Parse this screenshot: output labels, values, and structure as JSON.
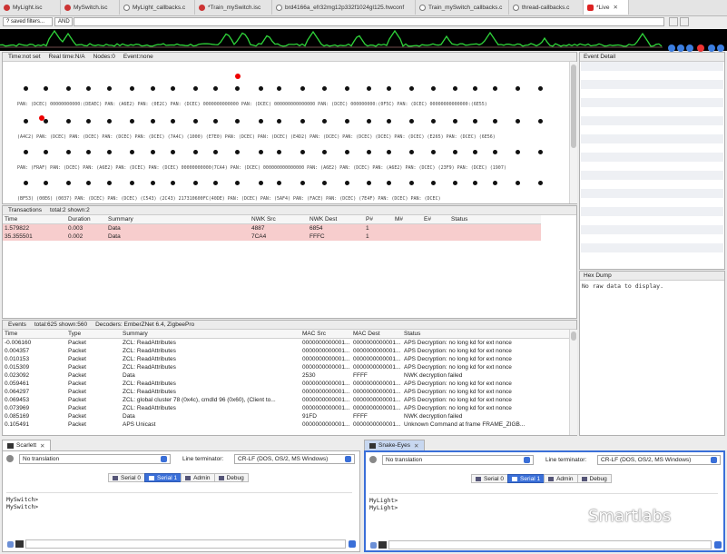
{
  "tabs": [
    {
      "label": "MyLight.isc",
      "icon": "red",
      "width": 67
    },
    {
      "label": "MySwitch.isc",
      "icon": "red",
      "width": 65
    },
    {
      "label": "MyLight_callbacks.c",
      "icon": "c",
      "width": 83
    },
    {
      "label": "*Train_mySwitch.isc",
      "icon": "red",
      "width": 85
    },
    {
      "label": "brd4166a_efr32mg12p332f1024gl125.hwconf",
      "icon": "c",
      "width": 158
    },
    {
      "label": "Train_mySwitch_callbacks.c",
      "icon": "c",
      "width": 103
    },
    {
      "label": "thread-callbacks.c",
      "icon": "c",
      "width": 82
    },
    {
      "label": "*Live",
      "icon": "live",
      "width": 50,
      "active": true
    }
  ],
  "filter": {
    "saved": "? saved filters...",
    "mode": "AND"
  },
  "network": {
    "status": [
      "Time:not set",
      "Real time:N/A",
      "Nodes:0",
      "Event:none"
    ],
    "row1_text": "PAN: (DCEC) 00000000000:(DEAEC)   PAN: (A6E2)   PAN: (0E2C) PAN: (DCEC) 0000000000000 PAN: (DCEC) 000000000000000 PAN: (DCEC) 000000000:(0F5C)   PAN: (DCEC) 00000000000000:(6E55)",
    "row2_text": "(A4C2)  PAN: (DCEC) PAN: (DCEC)  PAN: (DCEC) PAN: (DCEC) (7A4C)  (1000)  (E7E0)  PAN: (DCEC) PAN: (DCEC) (E4D2) PAN: (DCEC) PAN: (DCEC) (DCEC)  PAN: (DCEC) (E265)  PAN: (DCEC) (6E56)",
    "row3_text": "PAN: (FRAF)  PAN: (DCEC)  PAN: (A6E2)  PAN: (DCEC) PAN: (DCEC) 00000000000(7CA4)  PAN: (DCEC) 000000000000000 PAN: (A6E2) PAN: (DCEC) PAN: (A6E2) PAN: (DCEC) (23F9) PAN: (DCEC) (1907)",
    "row4_text": "(BF53)   (00E6)  (0037)  PAN: (DCEC) PAN: (DCEC) (C543)  (2C43)  217310600FC(40DE) PAN: (DCEC) PAN: (5AF4) PAN: (FACE) PAN: (DCEC) (7E4F)  PAN: (DCEC) PAN: (DCEC)"
  },
  "transactions": {
    "title": "Transactions",
    "summary": "total:2 shown:2",
    "columns": [
      "Time",
      "Duration",
      "Summary",
      "NWK Src",
      "NWK Dest",
      "P#",
      "M#",
      "E#",
      "Status"
    ],
    "rows": [
      [
        "1.579822",
        "0.003",
        "Data",
        "4887",
        "6854",
        "1",
        "",
        "",
        ""
      ],
      [
        "35.355501",
        "0.002",
        "Data",
        "7CA4",
        "FFFC",
        "1",
        "",
        "",
        ""
      ]
    ]
  },
  "events": {
    "title": "Events",
    "summary": "total:625 shown:560",
    "decoders": "Decoders: EmberZNet 6.4, ZigbeePro",
    "columns": [
      "Time",
      "Type",
      "Summary",
      "MAC Src",
      "MAC Dest",
      "Status"
    ],
    "rows": [
      [
        "-0.006160",
        "Packet",
        "ZCL: ReadAttributes",
        "0000000000001...",
        "0000000000001...",
        "APS Decryption: no long kd for ext nonce"
      ],
      [
        "0.004357",
        "Packet",
        "ZCL: ReadAttributes",
        "0000000000001...",
        "0000000000001...",
        "APS Decryption: no long kd for ext nonce"
      ],
      [
        "0.010153",
        "Packet",
        "ZCL: ReadAttributes",
        "0000000000001...",
        "0000000000001...",
        "APS Decryption: no long kd for ext nonce"
      ],
      [
        "0.015309",
        "Packet",
        "ZCL: ReadAttributes",
        "0000000000001...",
        "0000000000001...",
        "APS Decryption: no long kd for ext nonce"
      ],
      [
        "0.023092",
        "Packet",
        "Data",
        "2530",
        "FFFF",
        "NWK decryption failed"
      ],
      [
        "0.059461",
        "Packet",
        "ZCL: ReadAttributes",
        "0000000000001...",
        "0000000000001...",
        "APS Decryption: no long kd for ext nonce"
      ],
      [
        "0.064297",
        "Packet",
        "ZCL: ReadAttributes",
        "0000000000001...",
        "0000000000001...",
        "APS Decryption: no long kd for ext nonce"
      ],
      [
        "0.069453",
        "Packet",
        "ZCL: global cluster 78 (0x4c), cmdId 96 (0x60), (Client to...",
        "0000000000001...",
        "0000000000001...",
        "APS Decryption: no long kd for ext nonce"
      ],
      [
        "0.073969",
        "Packet",
        "ZCL: ReadAttributes",
        "0000000000001...",
        "0000000000001...",
        "APS Decryption: no long kd for ext nonce"
      ],
      [
        "0.085169",
        "Packet",
        "Data",
        "91FD",
        "FFFF",
        "NWK decryption failed"
      ],
      [
        "0.105491",
        "Packet",
        "APS Unicast",
        "0000000000001...",
        "0000000000001...",
        "Unknown Command at frame FRAME_ZIGB..."
      ]
    ]
  },
  "event_detail": {
    "title": "Event Detail"
  },
  "hex_dump": {
    "title": "Hex Dump",
    "message": "No raw data to display."
  },
  "console_left": {
    "tab": "Scarlett",
    "translation": "No translation",
    "line_terminator_label": "Line terminator:",
    "line_terminator": "CR-LF  (DOS, OS/2, MS Windows)",
    "subtabs": [
      "Serial 0",
      "Serial 1",
      "Admin",
      "Debug"
    ],
    "active": 1,
    "output": [
      "MySwitch>",
      "MySwitch>"
    ]
  },
  "console_right": {
    "tab": "Snake-Eyes",
    "translation": "No translation",
    "line_terminator_label": "Line terminator:",
    "line_terminator": "CR-LF  (DOS, OS/2, MS Windows)",
    "subtabs": [
      "Serial 0",
      "Serial 1",
      "Admin",
      "Debug"
    ],
    "active": 1,
    "output": [
      "MyLight>",
      "MyLight>"
    ]
  },
  "watermark": "Smartlabs"
}
